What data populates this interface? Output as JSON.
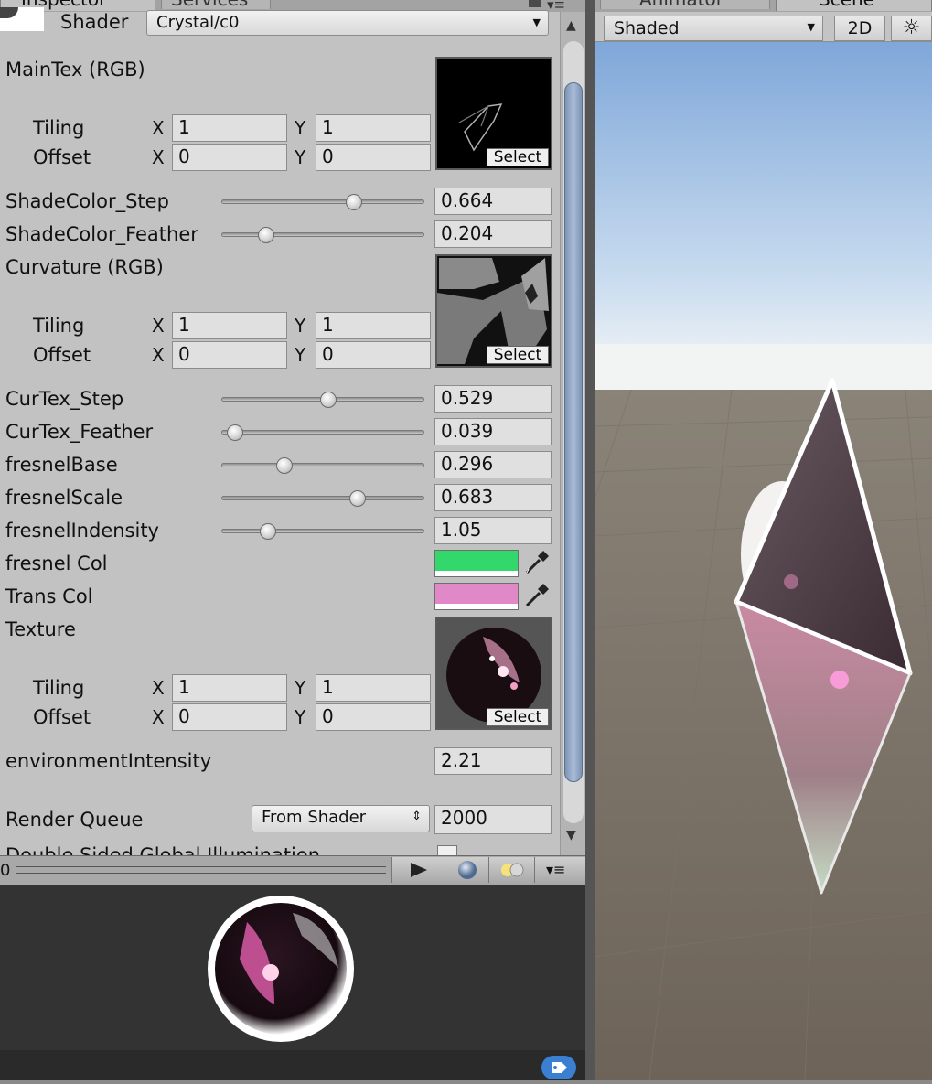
{
  "tabs_left": {
    "inspector": "Inspector",
    "services": "Services"
  },
  "tabs_right": {
    "animator": "Animator",
    "scene": "Scene"
  },
  "shader": {
    "label": "Shader",
    "value": "Crystal/c0"
  },
  "properties": {
    "main_tex": {
      "label": "MainTex (RGB)",
      "tiling_label": "Tiling",
      "offset_label": "Offset",
      "tiling_x": "1",
      "tiling_y": "1",
      "offset_x": "0",
      "offset_y": "0",
      "select_label": "Select"
    },
    "shadecolor_step": {
      "label": "ShadeColor_Step",
      "value": "0.664"
    },
    "shadecolor_feather": {
      "label": "ShadeColor_Feather",
      "value": "0.204"
    },
    "curvature": {
      "label": "Curvature (RGB)",
      "tiling_label": "Tiling",
      "offset_label": "Offset",
      "tiling_x": "1",
      "tiling_y": "1",
      "offset_x": "0",
      "offset_y": "0",
      "select_label": "Select"
    },
    "curtex_step": {
      "label": "CurTex_Step",
      "value": "0.529"
    },
    "curtex_feather": {
      "label": "CurTex_Feather",
      "value": "0.039"
    },
    "fresnel_base": {
      "label": "fresnelBase",
      "value": "0.296"
    },
    "fresnel_scale": {
      "label": "fresnelScale",
      "value": "0.683"
    },
    "fresnel_indensity": {
      "label": "fresnelIndensity",
      "value": "1.05"
    },
    "fresnel_col": {
      "label": "fresnel Col",
      "color": "#33d86c"
    },
    "trans_col": {
      "label": "Trans Col",
      "color": "#e088c8"
    },
    "texture": {
      "label": "Texture",
      "tiling_label": "Tiling",
      "offset_label": "Offset",
      "tiling_x": "1",
      "tiling_y": "1",
      "offset_x": "0",
      "offset_y": "0",
      "select_label": "Select"
    },
    "environment_intensity": {
      "label": "environmentIntensity",
      "value": "2.21"
    },
    "render_queue": {
      "label": "Render Queue",
      "mode": "From Shader",
      "value": "2000"
    },
    "double_sided_gi": {
      "label": "Double Sided Global Illumination"
    }
  },
  "axis_labels": {
    "x": "X",
    "y": "Y"
  },
  "scene_toolbar": {
    "draw_mode": "Shaded",
    "mode_2d": "2D"
  },
  "icons": {
    "lock": "lock-icon",
    "menu": "menu-icon",
    "play": "play-icon",
    "sphere": "sphere-icon",
    "lights": "lights-icon",
    "label": "label-icon",
    "eyedropper": "eyedropper-icon",
    "sun": "sun-icon"
  }
}
